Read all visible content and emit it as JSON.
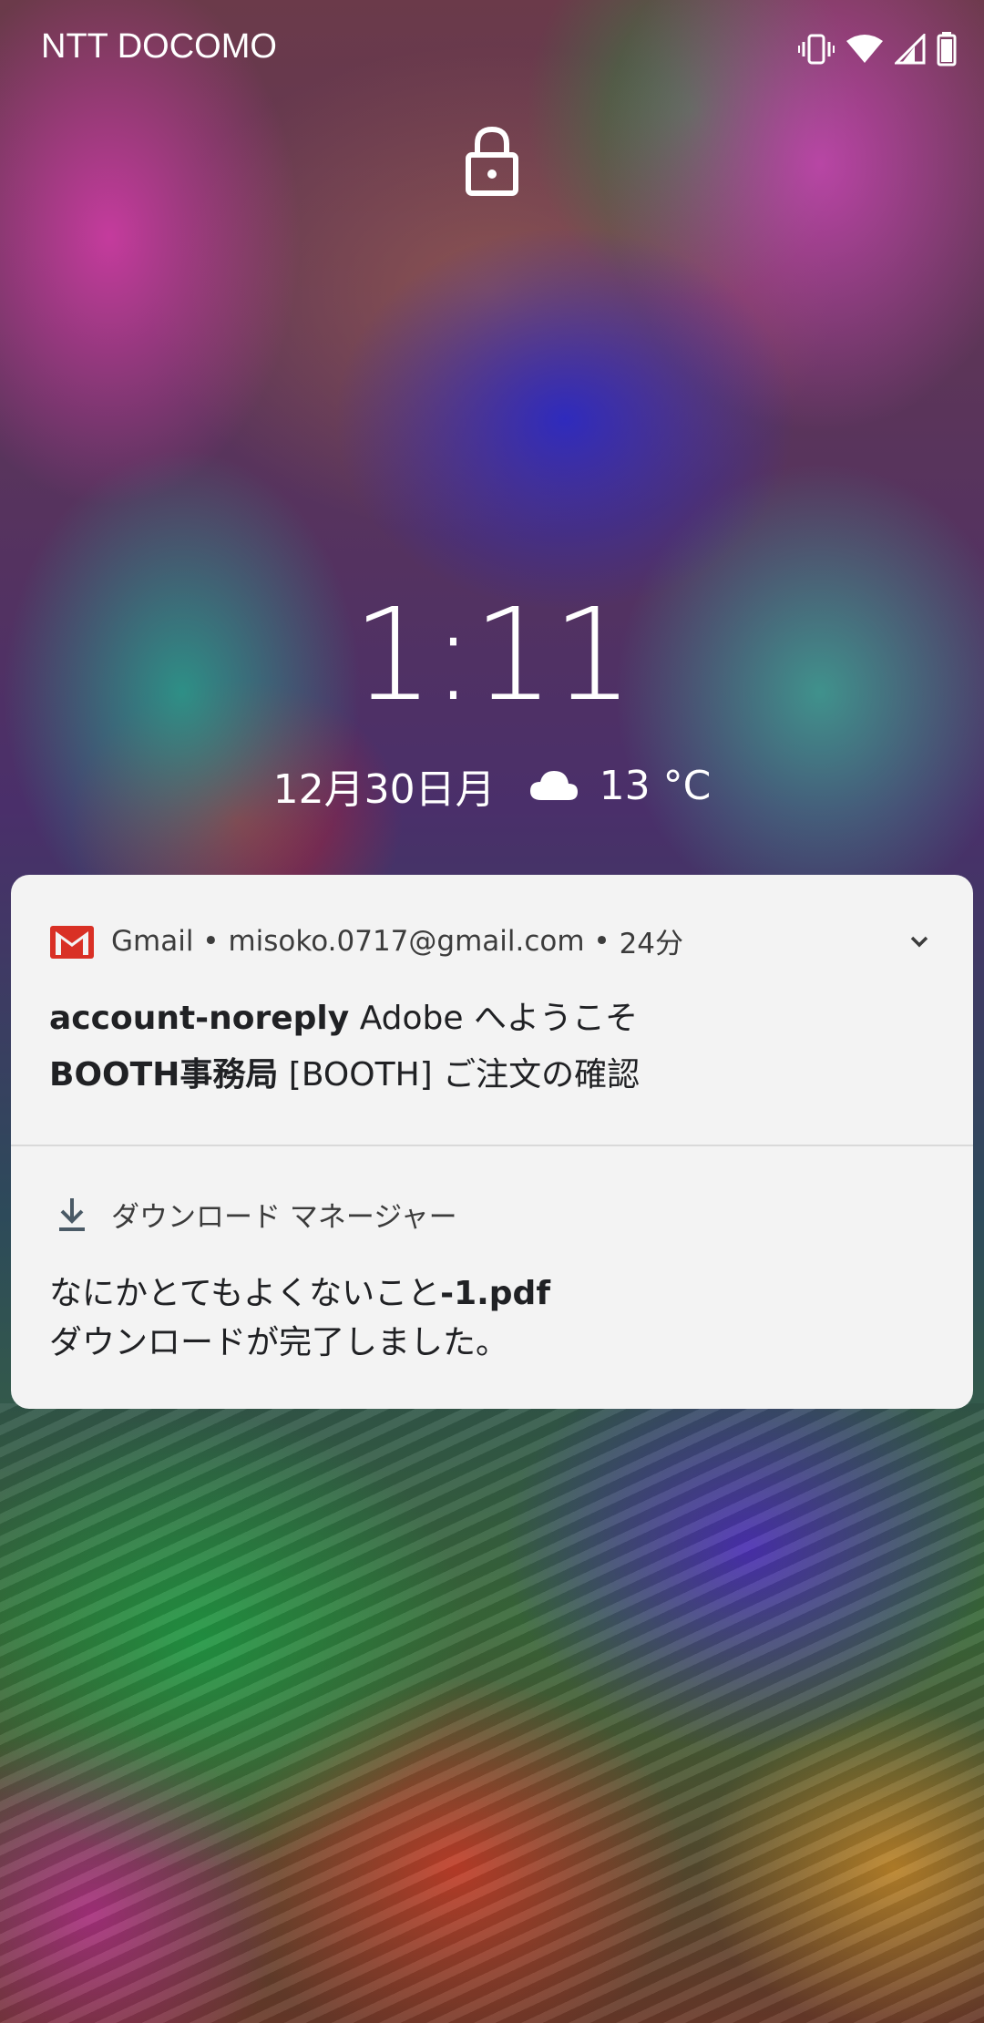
{
  "status_bar": {
    "carrier": "NTT DOCOMO",
    "icons": [
      "vibrate-icon",
      "wifi-icon",
      "signal-icon",
      "battery-icon"
    ]
  },
  "lockscreen": {
    "lock_icon": "lock-icon",
    "time": "1:11",
    "date": "12月30日月",
    "weather_icon": "cloud-icon",
    "temperature": "13 °C"
  },
  "notifications": {
    "gmail": {
      "app_icon": "gmail-icon",
      "app_name": "Gmail",
      "separator1": " • ",
      "account": "misoko.0717@gmail.com",
      "separator2": " • ",
      "time_ago": "24分",
      "expand_icon": "chevron-down-icon",
      "messages": [
        {
          "sender": "account-noreply",
          "subject": "Adobe へようこそ"
        },
        {
          "sender": "BOOTH事務局",
          "subject": "[BOOTH] ご注文の確認"
        }
      ]
    },
    "download": {
      "app_icon": "download-icon",
      "app_name": "ダウンロード マネージャー",
      "file_name_prefix": "なにかとてもよくないこと",
      "file_name_suffix": "-1.pdf",
      "status": "ダウンロードが完了しました。"
    }
  },
  "colors": {
    "card_background": "#f3f3f3",
    "text_primary": "#202124",
    "gmail_red": "#d93025"
  }
}
